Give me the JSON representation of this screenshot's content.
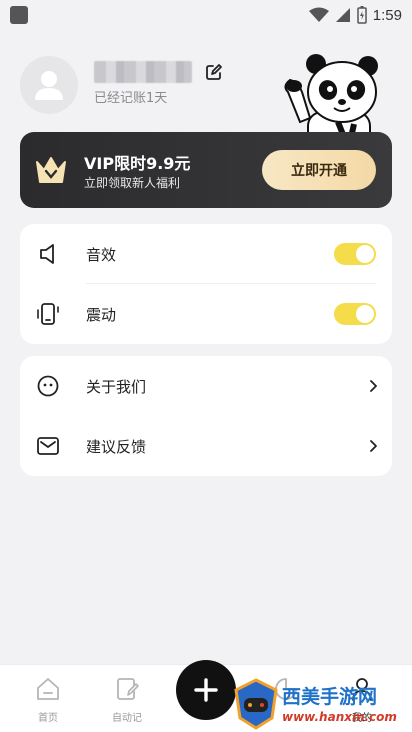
{
  "status_bar": {
    "time": "1:59"
  },
  "profile": {
    "days_text": "已经记账1天"
  },
  "vip": {
    "title": "VIP限时9.9元",
    "subtitle": "立即领取新人福利",
    "button_label": "立即开通"
  },
  "settings": {
    "sound_label": "音效",
    "sound_on": true,
    "vibration_label": "震动",
    "vibration_on": true
  },
  "links": {
    "about_label": "关于我们",
    "feedback_label": "建议反馈"
  },
  "tabbar": {
    "home_label": "首页",
    "auto_label": "自动记",
    "stats_label": "",
    "mine_label": "我的"
  },
  "watermark": {
    "text": "西美手游网",
    "url": "www.hanxm.com"
  },
  "colors": {
    "accent": "#f4dc4a",
    "vip_bg": "#2b2b2d",
    "vip_button": "#f6e2b6"
  }
}
